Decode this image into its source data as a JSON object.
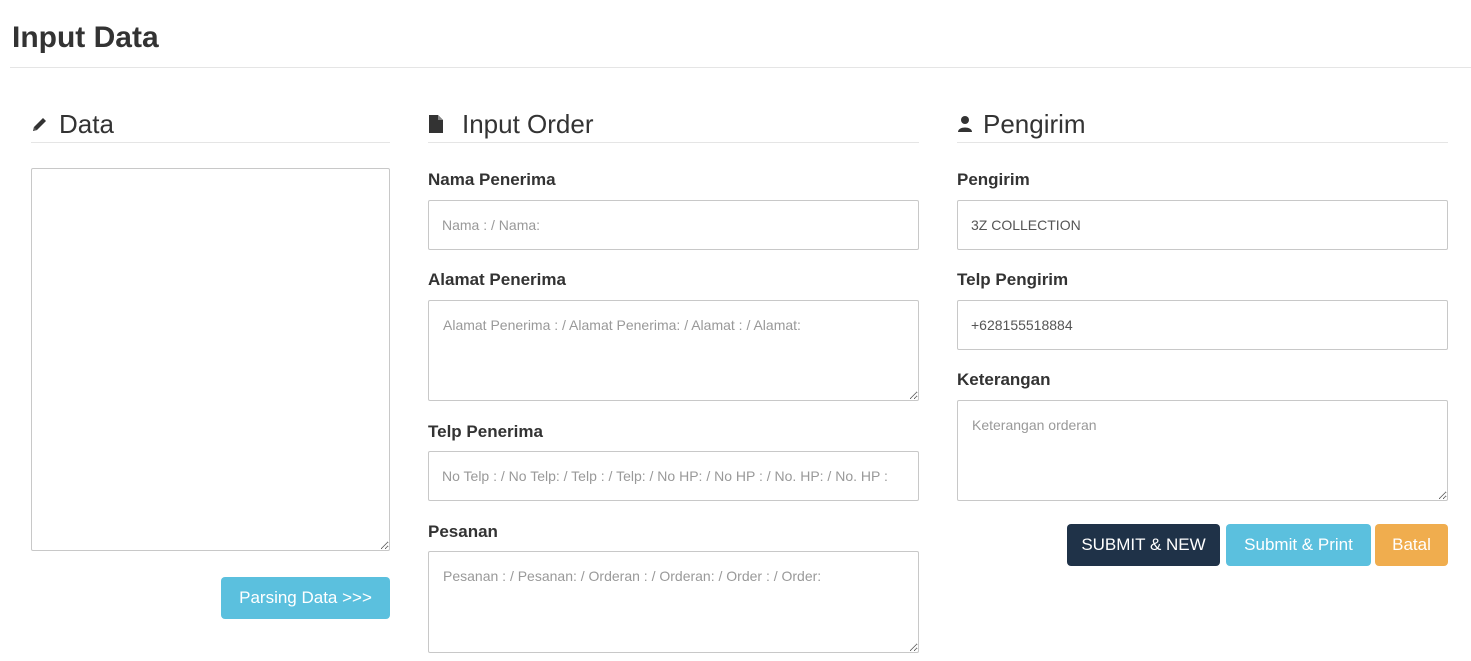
{
  "page": {
    "title": "Input Data"
  },
  "data_section": {
    "heading": "Data",
    "icon": "pencil-icon",
    "textarea_value": "",
    "parse_button": "Parsing Data >>>"
  },
  "order_section": {
    "heading": "Input Order",
    "icon": "file-icon",
    "nama_label": "Nama Penerima",
    "nama_placeholder": "Nama : / Nama:",
    "alamat_label": "Alamat Penerima",
    "alamat_placeholder": "Alamat Penerima : / Alamat Penerima: / Alamat : / Alamat:",
    "telp_label": "Telp Penerima",
    "telp_placeholder": "No Telp : / No Telp: / Telp : / Telp: / No HP: / No HP : / No. HP: / No. HP :",
    "pesanan_label": "Pesanan",
    "pesanan_placeholder": "Pesanan : / Pesanan: / Orderan : / Orderan: / Order : / Order:"
  },
  "sender_section": {
    "heading": "Pengirim",
    "icon": "user-icon",
    "pengirim_label": "Pengirim",
    "pengirim_value": "3Z COLLECTION",
    "telp_label": "Telp Pengirim",
    "telp_value": "+628155518884",
    "keterangan_label": "Keterangan",
    "keterangan_placeholder": "Keterangan orderan",
    "submit_new_button": "SUBMIT & NEW",
    "submit_print_button": "Submit & Print",
    "cancel_button": "Batal"
  },
  "colors": {
    "primary_dark": "#1f3248",
    "info": "#5bc0de",
    "warning": "#f0ad4e"
  }
}
